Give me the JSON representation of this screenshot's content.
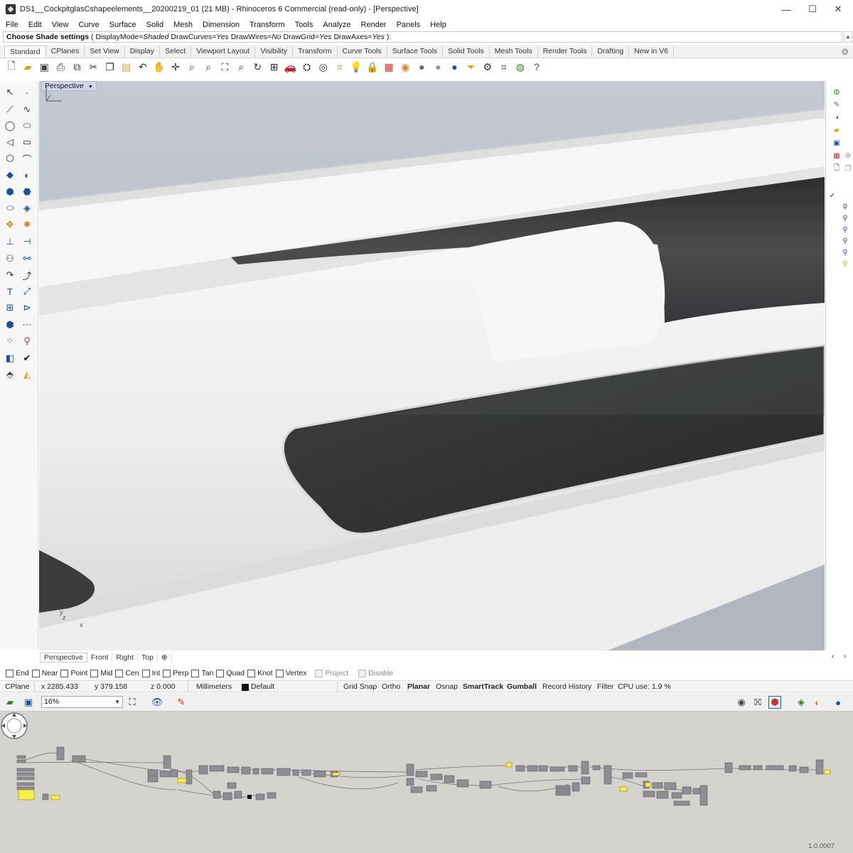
{
  "window": {
    "title": "DS1__CockpitglasCshapeelements__20200219_01 (21 MB) - Rhinoceros 6 Commercial (read-only) - [Perspective]",
    "controls": {
      "minimize": "—",
      "maximize": "☐",
      "close": "✕"
    }
  },
  "menu": [
    "File",
    "Edit",
    "View",
    "Curve",
    "Surface",
    "Solid",
    "Mesh",
    "Dimension",
    "Transform",
    "Tools",
    "Analyze",
    "Render",
    "Panels",
    "Help"
  ],
  "command": {
    "prompt": "Choose Shade settings",
    "open": " ( DisplayMode=",
    "display_mode": "Shaded",
    "curves_label": "  DrawCurves=",
    "curves": "Yes",
    "wires_label": "  DrawWires=",
    "wires": "No",
    "grid_label": "  DrawGrid=",
    "grid": "Yes",
    "axes_label": "  DrawAxes=",
    "axes": "Yes",
    "close": " ):"
  },
  "tabs": [
    "Standard",
    "CPlanes",
    "Set View",
    "Display",
    "Select",
    "Viewport Layout",
    "Visibility",
    "Transform",
    "Curve Tools",
    "Surface Tools",
    "Solid Tools",
    "Mesh Tools",
    "Render Tools",
    "Drafting",
    "New in V6"
  ],
  "toolbar_icons": [
    "new-icon",
    "open-icon",
    "save-icon",
    "print-icon",
    "import-icon",
    "cut-icon",
    "copy-icon",
    "paste-icon",
    "undo-icon",
    "pan-icon",
    "rotate-view-icon",
    "zoom-icon",
    "zoom-window-icon",
    "zoom-extents-icon",
    "zoom-selected-icon",
    "rotate-icon",
    "four-viewports-icon",
    "car-icon",
    "cplane-icon",
    "ellipse-icon",
    "snap-icon",
    "light-icon",
    "lock-icon",
    "materials-icon",
    "color-wheel-icon",
    "shaded-sphere-icon",
    "rendered-sphere-icon",
    "globe-sphere-icon",
    "funnel-icon",
    "gear-icon",
    "grid-toggle-icon",
    "earth-icon",
    "help-icon"
  ],
  "viewport": {
    "name": "Perspective",
    "axis_y": "y",
    "axis_z": "z",
    "axis_x": "x"
  },
  "viewport_tabs": [
    "Perspective",
    "Front",
    "Right",
    "Top"
  ],
  "viewport_tab_add": "⊕",
  "osnaps": [
    {
      "label": "End",
      "checked": false
    },
    {
      "label": "Near",
      "checked": false
    },
    {
      "label": "Point",
      "checked": false
    },
    {
      "label": "Mid",
      "checked": false
    },
    {
      "label": "Cen",
      "checked": false
    },
    {
      "label": "Int",
      "checked": false
    },
    {
      "label": "Perp",
      "checked": false
    },
    {
      "label": "Tan",
      "checked": false
    },
    {
      "label": "Quad",
      "checked": false
    },
    {
      "label": "Knot",
      "checked": false
    },
    {
      "label": "Vertex",
      "checked": false
    },
    {
      "label": "Project",
      "checked": false,
      "disabled": true
    },
    {
      "label": "Disable",
      "checked": false,
      "disabled": true
    }
  ],
  "status": {
    "cplane": "CPlane",
    "x": "x 2285.433",
    "y": "y 379.158",
    "z": "z 0.000",
    "units": "Millimeters",
    "layer": "Default",
    "grid_snap": "Grid Snap",
    "ortho": "Ortho",
    "planar": "Planar",
    "osnap": "Osnap",
    "smarttrack": "SmartTrack",
    "gumball": "Gumball",
    "record_history": "Record History",
    "filter": "Filter",
    "cpu": "CPU use: 1.9 %"
  },
  "grasshopper": {
    "zoom": "16%",
    "version": "1.0.0007"
  },
  "colors": {
    "viewport_bg": "#b9bfca",
    "body_white": "#f2f2f2",
    "glass_dark": "#3c3e3f",
    "gh_canvas": "#d4d3cd",
    "gh_component": "#8f8e94",
    "gh_panel": "#f8ee4a"
  }
}
